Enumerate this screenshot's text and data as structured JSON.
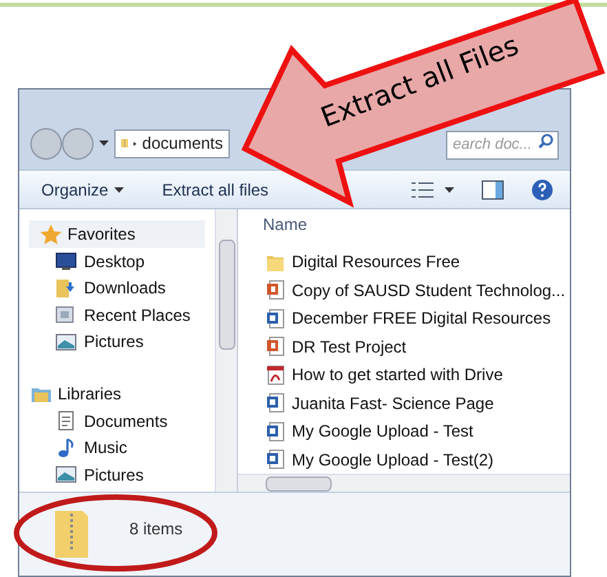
{
  "callout": {
    "text": "Extract all Files"
  },
  "window": {
    "address": "documents",
    "search_placeholder": "earch doc..."
  },
  "toolbar": {
    "organize": "Organize",
    "extract": "Extract all files"
  },
  "navigation": [
    {
      "label": "Favorites",
      "kind": "star",
      "children": [
        {
          "label": "Desktop",
          "kind": "desktop"
        },
        {
          "label": "Downloads",
          "kind": "downloads"
        },
        {
          "label": "Recent Places",
          "kind": "recent"
        },
        {
          "label": "Pictures",
          "kind": "pictures"
        }
      ]
    },
    {
      "label": "Libraries",
      "kind": "library",
      "children": [
        {
          "label": "Documents",
          "kind": "documents"
        },
        {
          "label": "Music",
          "kind": "music"
        },
        {
          "label": "Pictures",
          "kind": "pictures"
        }
      ]
    }
  ],
  "file_list": {
    "column": "Name",
    "files": [
      {
        "name": "Digital Resources Free",
        "kind": "folder"
      },
      {
        "name": "Copy of SAUSD Student Technolog...",
        "kind": "powerpoint"
      },
      {
        "name": "December FREE Digital Resources",
        "kind": "word"
      },
      {
        "name": "DR Test Project",
        "kind": "powerpoint"
      },
      {
        "name": "How to get started with Drive",
        "kind": "pdf"
      },
      {
        "name": "Juanita Fast- Science Page",
        "kind": "word"
      },
      {
        "name": "My Google Upload - Test",
        "kind": "word"
      },
      {
        "name": "My Google Upload - Test(2)",
        "kind": "word"
      }
    ]
  },
  "status_bar": {
    "count": "8 items"
  }
}
